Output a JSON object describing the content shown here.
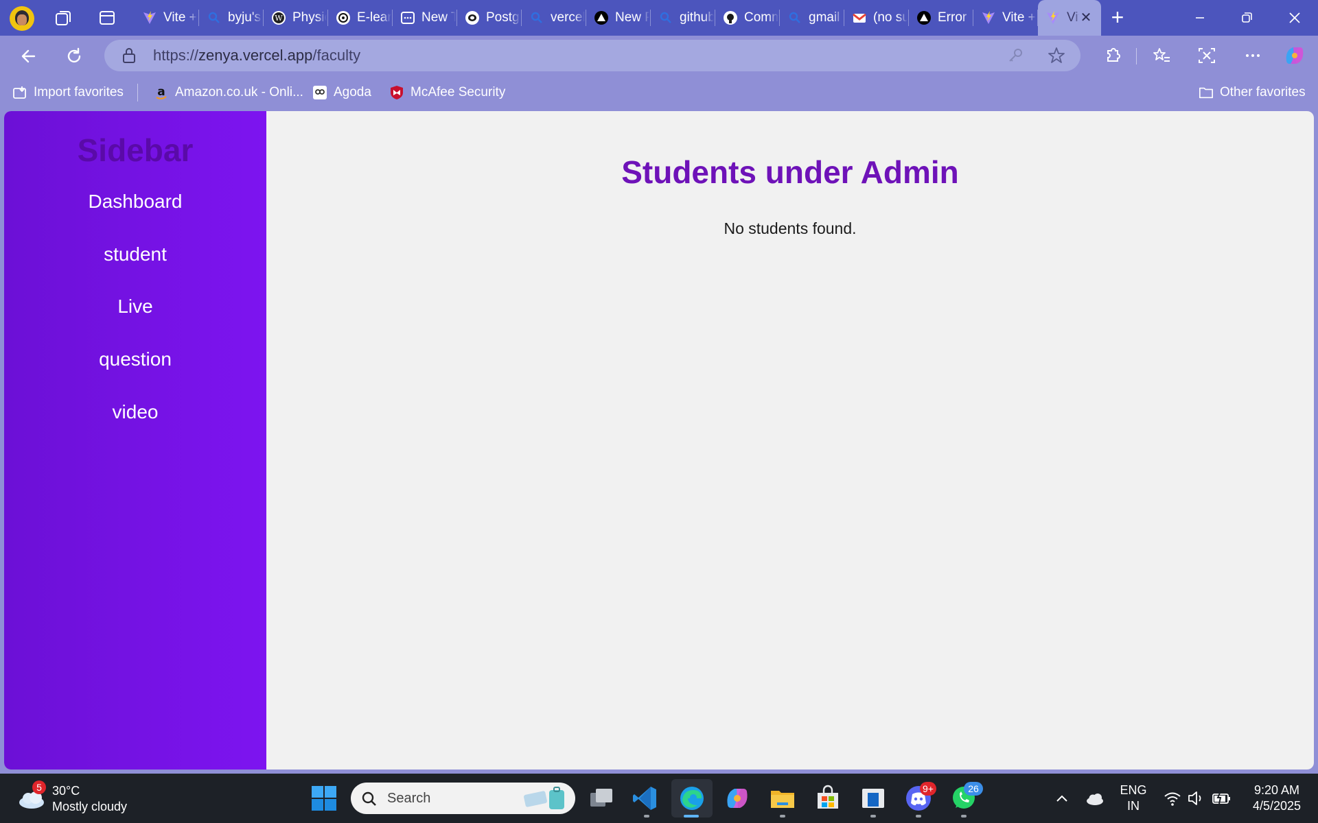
{
  "browser": {
    "tabs": [
      {
        "title": "Vite + React"
      },
      {
        "title": "byju's"
      },
      {
        "title": "Physics"
      },
      {
        "title": "E-learning"
      },
      {
        "title": "New Tab"
      },
      {
        "title": "PostgreSQL"
      },
      {
        "title": "vercel"
      },
      {
        "title": "New Project"
      },
      {
        "title": "github"
      },
      {
        "title": "Commits"
      },
      {
        "title": "gmail"
      },
      {
        "title": "(no subject)"
      },
      {
        "title": "Error"
      },
      {
        "title": "Vite + React"
      },
      {
        "title": "Vite + React",
        "active": true
      }
    ],
    "address": {
      "prefix": "https://",
      "domain": "zenya.vercel.app",
      "path": "/faculty"
    },
    "favorites": [
      {
        "label": "Import favorites"
      },
      {
        "label": "Amazon.co.uk - Onli..."
      },
      {
        "label": "Agoda"
      },
      {
        "label": "McAfee Security"
      }
    ],
    "other_favorites": "Other favorites"
  },
  "page": {
    "sidebar": {
      "title": "Sidebar",
      "items": [
        "Dashboard",
        "student",
        "Live",
        "question",
        "video"
      ]
    },
    "main": {
      "title": "Students under Admin",
      "message": "No students found."
    },
    "colors": {
      "sidebar_bg": "#7512e6",
      "title_color": "#6e12b8",
      "content_bg": "#f1f1f1"
    }
  },
  "taskbar": {
    "weather": {
      "temp": "30°C",
      "condition": "Mostly cloudy",
      "badge": "5"
    },
    "search_placeholder": "Search",
    "discord_badge": "9+",
    "whatsapp_badge": "26",
    "language": {
      "line1": "ENG",
      "line2": "IN"
    },
    "clock": {
      "time": "9:20 AM",
      "date": "4/5/2025"
    }
  }
}
